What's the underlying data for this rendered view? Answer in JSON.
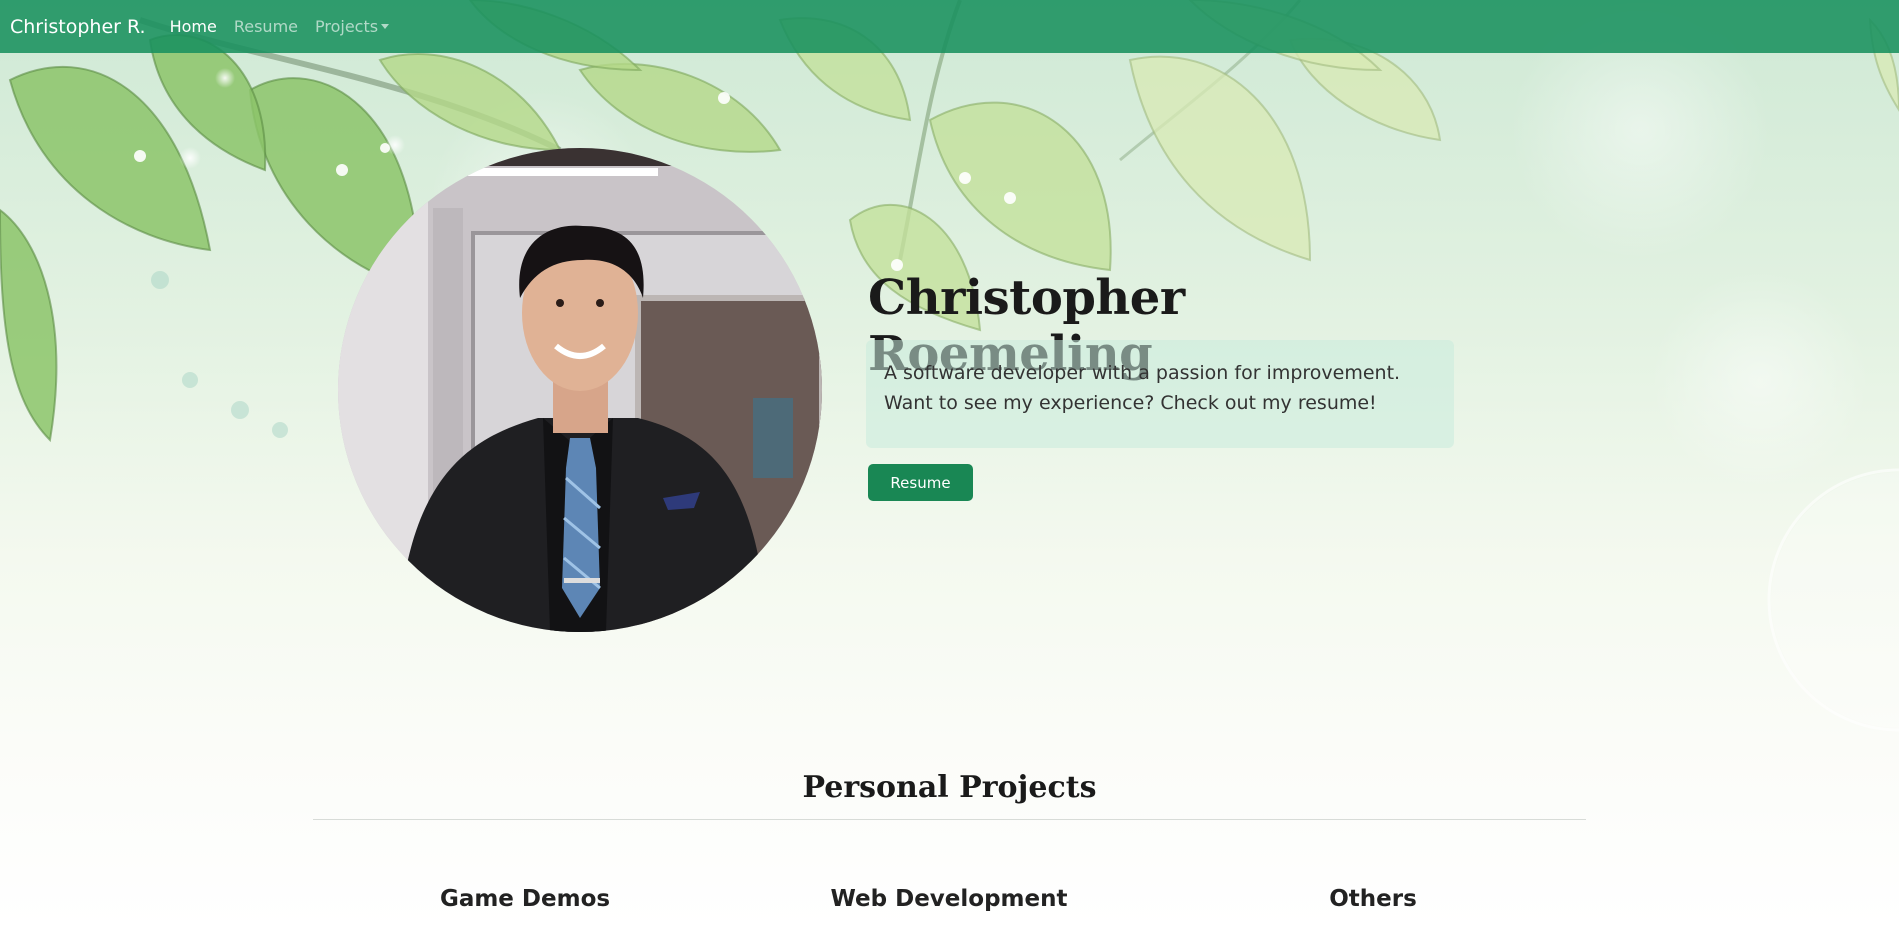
{
  "navbar": {
    "brand": "Christopher R.",
    "links": [
      {
        "label": "Home",
        "active": true
      },
      {
        "label": "Resume",
        "active": false
      },
      {
        "label": "Projects",
        "active": false
      }
    ]
  },
  "hero": {
    "name": "Christopher Roemeling",
    "tagline": "A software developer with a passion for improvement. Want to see my experience? Check out my resume!",
    "button_label": "Resume"
  },
  "projects": {
    "title": "Personal Projects",
    "columns": [
      "Game Demos",
      "Web Development",
      "Others"
    ]
  },
  "colors": {
    "navbar": "#19915f",
    "accent": "#198754"
  }
}
